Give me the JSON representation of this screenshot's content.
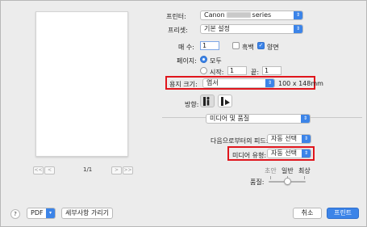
{
  "preview": {
    "page_indicator": "1/1",
    "first_label": "<<",
    "prev_label": "<",
    "next_label": ">",
    "last_label": ">>"
  },
  "printer": {
    "label": "프린터:",
    "value_prefix": "Canon",
    "value_suffix": "series"
  },
  "preset": {
    "label": "프리셋:",
    "value": "기본 설정"
  },
  "copies": {
    "label": "매 수:",
    "value": "1",
    "bw_label": "흑백",
    "duplex_label": "양면",
    "bw_checked": false,
    "duplex_checked": true
  },
  "pages": {
    "label": "페이지:",
    "all_label": "모두",
    "from_label": "시작:",
    "from_value": "1",
    "to_label": "끝:",
    "to_value": "1"
  },
  "paper_size": {
    "label": "용지 크기:",
    "value": "엽서",
    "dimensions": "100 x 148mm"
  },
  "orientation": {
    "label": "방향:"
  },
  "section_menu": {
    "value": "미디어 및 품질"
  },
  "feed_from": {
    "label": "다음으로부터의 피드:",
    "value": "자동 선택"
  },
  "media_type": {
    "label": "미디어 유형:",
    "value": "자동 선택"
  },
  "quality": {
    "label": "품질:",
    "draft_label": "초안",
    "normal_label": "일반",
    "best_label": "최상",
    "level": "normal"
  },
  "footer": {
    "help_label": "?",
    "pdf_label": "PDF",
    "details_label": "세부사항 가리기",
    "cancel_label": "취소",
    "print_label": "프린트"
  },
  "colors": {
    "accent": "#3c84e8",
    "highlight_border": "#e0151c"
  }
}
